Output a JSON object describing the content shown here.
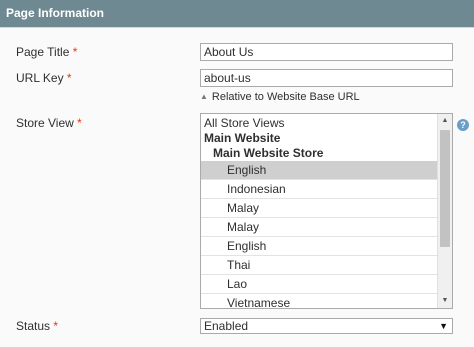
{
  "section": {
    "title": "Page Information"
  },
  "fields": {
    "page_title": {
      "label": "Page Title",
      "required": "*",
      "value": "About Us"
    },
    "url_key": {
      "label": "URL Key",
      "required": "*",
      "value": "about-us",
      "hint": "Relative to Website Base URL"
    },
    "store_view": {
      "label": "Store View",
      "required": "*",
      "options": {
        "all": "All Store Views",
        "website": "Main Website",
        "store": "Main Website Store",
        "views": [
          "English",
          "Indonesian",
          "Malay",
          "Malay",
          "English",
          "Thai",
          "Lao",
          "Vietnamese"
        ]
      },
      "selected_view": "English"
    },
    "status": {
      "label": "Status",
      "required": "*",
      "value": "Enabled"
    }
  },
  "icons": {
    "hint_arrow": "up-triangle-icon",
    "help": "help-icon",
    "caret": "chevron-down-icon"
  },
  "colors": {
    "header_bg": "#6f8992",
    "required": "#eb340a",
    "selected_option_bg": "#cfcfcf",
    "help_icon": "#6a9ec9"
  }
}
